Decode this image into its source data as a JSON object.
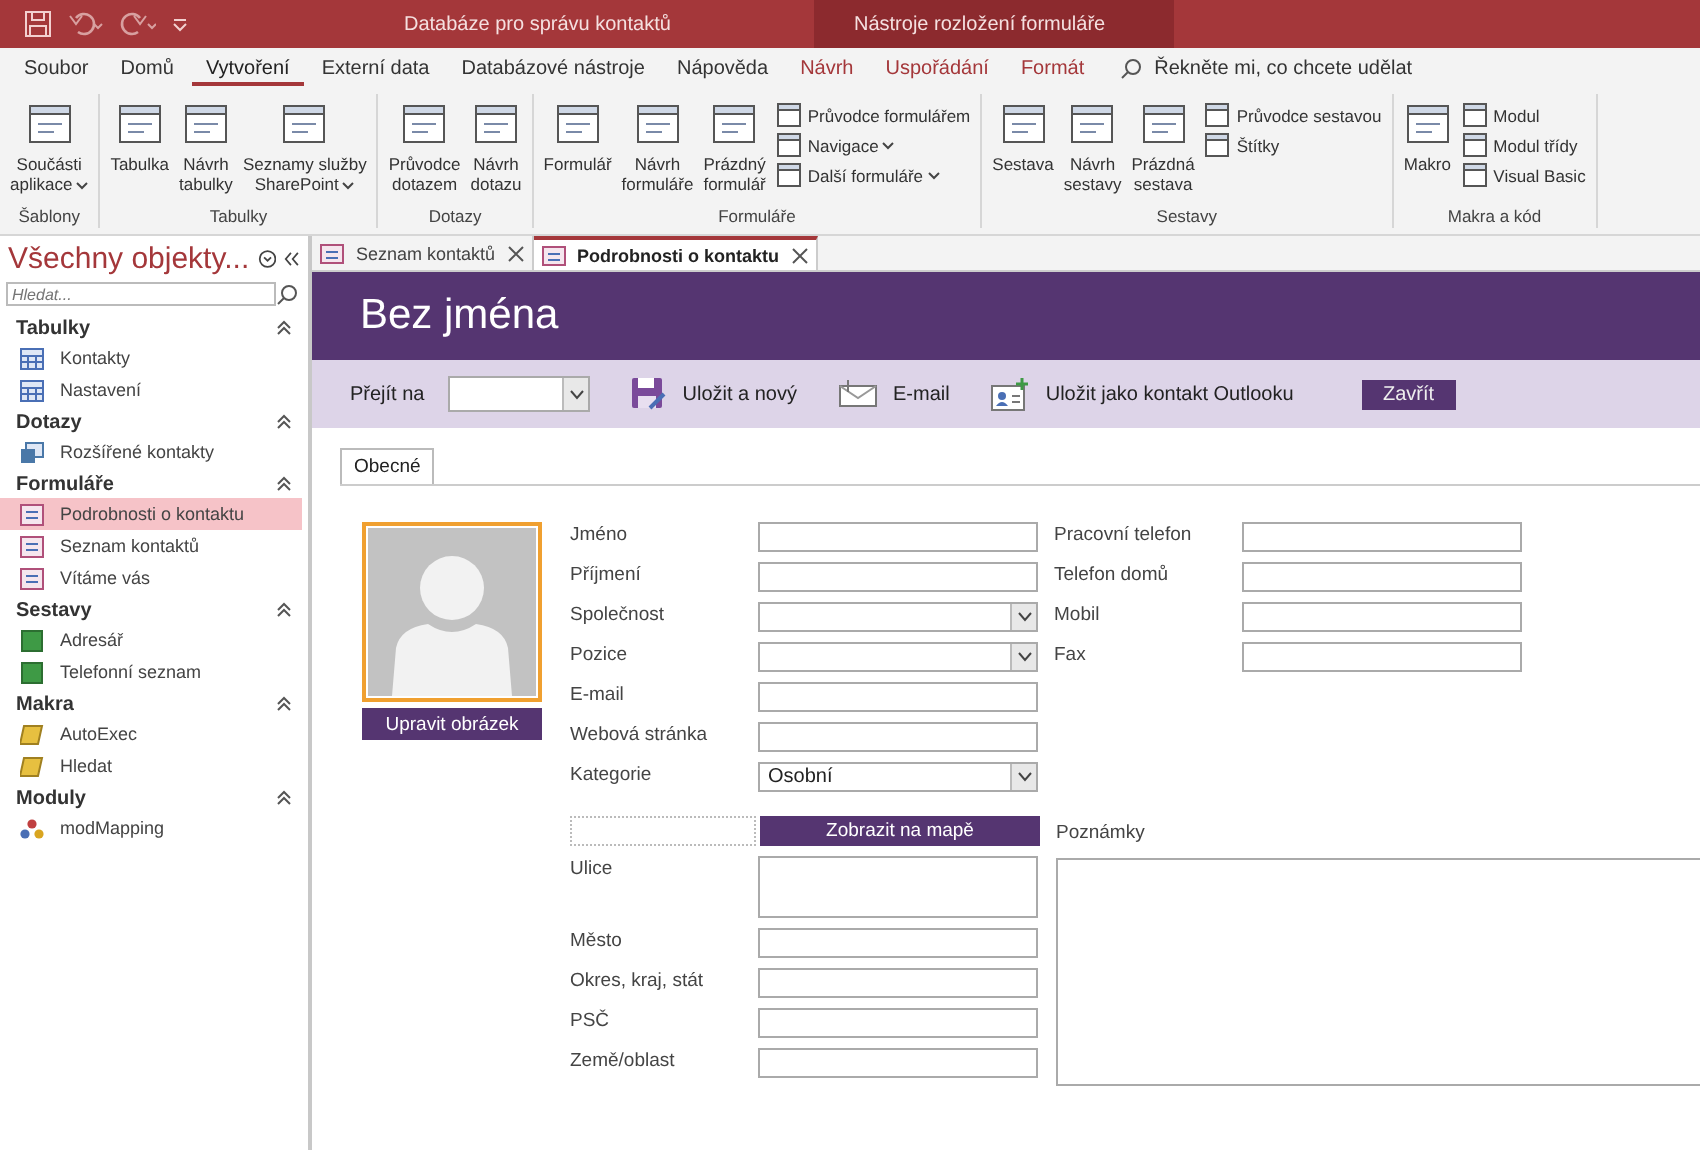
{
  "title_bar": {
    "title": "Databáze pro správu kontaktů",
    "context_title": "Nástroje rozložení formuláře"
  },
  "ribbon_tabs": [
    {
      "label": "Soubor",
      "selected": false,
      "contextual": false
    },
    {
      "label": "Domů",
      "selected": false,
      "contextual": false
    },
    {
      "label": "Vytvoření",
      "selected": true,
      "contextual": false
    },
    {
      "label": "Externí data",
      "selected": false,
      "contextual": false
    },
    {
      "label": "Databázové nástroje",
      "selected": false,
      "contextual": false
    },
    {
      "label": "Nápověda",
      "selected": false,
      "contextual": false
    },
    {
      "label": "Návrh",
      "selected": false,
      "contextual": true
    },
    {
      "label": "Uspořádání",
      "selected": false,
      "contextual": true
    },
    {
      "label": "Formát",
      "selected": false,
      "contextual": true
    }
  ],
  "tell_me": {
    "label": "Řekněte mi, co chcete udělat"
  },
  "ribbon_groups": [
    {
      "label": "Šablony",
      "items": [
        {
          "kind": "large",
          "label": "Součásti\naplikace",
          "dropdown": true
        }
      ]
    },
    {
      "label": "Tabulky",
      "items": [
        {
          "kind": "large",
          "label": "Tabulka",
          "dropdown": false
        },
        {
          "kind": "large",
          "label": "Návrh\ntabulky",
          "dropdown": false
        },
        {
          "kind": "large",
          "label": "Seznamy služby\nSharePoint",
          "dropdown": true
        }
      ]
    },
    {
      "label": "Dotazy",
      "items": [
        {
          "kind": "large",
          "label": "Průvodce\ndotazem",
          "dropdown": false
        },
        {
          "kind": "large",
          "label": "Návrh\ndotazu",
          "dropdown": false
        }
      ]
    },
    {
      "label": "Formuláře",
      "items": [
        {
          "kind": "large",
          "label": "Formulář",
          "dropdown": false
        },
        {
          "kind": "large",
          "label": "Návrh\nformuláře",
          "dropdown": false
        },
        {
          "kind": "large",
          "label": "Prázdný\nformulář",
          "dropdown": false
        },
        {
          "kind": "small",
          "label": "Průvodce formulářem",
          "dropdown": false
        },
        {
          "kind": "small",
          "label": "Navigace",
          "dropdown": true
        },
        {
          "kind": "small",
          "label": "Další formuláře",
          "dropdown": true
        }
      ]
    },
    {
      "label": "Sestavy",
      "items": [
        {
          "kind": "large",
          "label": "Sestava",
          "dropdown": false
        },
        {
          "kind": "large",
          "label": "Návrh\nsestavy",
          "dropdown": false
        },
        {
          "kind": "large",
          "label": "Prázdná\nsestava",
          "dropdown": false
        },
        {
          "kind": "small",
          "label": "Průvodce sestavou",
          "dropdown": false
        },
        {
          "kind": "small",
          "label": "Štítky",
          "dropdown": false
        }
      ]
    },
    {
      "label": "Makra a kód",
      "items": [
        {
          "kind": "large",
          "label": "Makro",
          "dropdown": false
        },
        {
          "kind": "small",
          "label": "Modul",
          "dropdown": false
        },
        {
          "kind": "small",
          "label": "Modul třídy",
          "dropdown": false
        },
        {
          "kind": "small",
          "label": "Visual Basic",
          "dropdown": false
        }
      ]
    }
  ],
  "nav": {
    "title": "Všechny objekty...",
    "search": {
      "placeholder": "Hledat..."
    },
    "sections": [
      {
        "label": "Tabulky",
        "kind": "table",
        "items": [
          {
            "label": "Kontakty",
            "selected": false
          },
          {
            "label": "Nastavení",
            "selected": false
          }
        ]
      },
      {
        "label": "Dotazy",
        "kind": "query",
        "items": [
          {
            "label": "Rozšířené kontakty",
            "selected": false
          }
        ]
      },
      {
        "label": "Formuláře",
        "kind": "form",
        "items": [
          {
            "label": "Podrobnosti o kontaktu",
            "selected": true
          },
          {
            "label": "Seznam kontaktů",
            "selected": false
          },
          {
            "label": "Vítáme vás",
            "selected": false
          }
        ]
      },
      {
        "label": "Sestavy",
        "kind": "report",
        "items": [
          {
            "label": "Adresář",
            "selected": false
          },
          {
            "label": "Telefonní seznam",
            "selected": false
          }
        ]
      },
      {
        "label": "Makra",
        "kind": "macro",
        "items": [
          {
            "label": "AutoExec",
            "selected": false
          },
          {
            "label": "Hledat",
            "selected": false
          }
        ]
      },
      {
        "label": "Moduly",
        "kind": "module",
        "items": [
          {
            "label": "modMapping",
            "selected": false
          }
        ]
      }
    ]
  },
  "doc_tabs": [
    {
      "label": "Seznam kontaktů",
      "selected": false
    },
    {
      "label": "Podrobnosti o kontaktu",
      "selected": true
    }
  ],
  "form": {
    "title": "Bez jména",
    "toolbar": {
      "goto_label": "Přejít na",
      "actions": [
        {
          "kind": "save",
          "label": "Uložit a nový"
        },
        {
          "kind": "email",
          "label": "E-mail"
        },
        {
          "kind": "contact",
          "label": "Uložit jako kontakt Outlooku"
        }
      ],
      "close": "Zavřít"
    },
    "tabs": [
      {
        "label": "Obecné",
        "selected": true
      }
    ],
    "photo_button": "Upravit obrázek",
    "left_fields": [
      {
        "label": "Jméno",
        "kind": "text"
      },
      {
        "label": "Příjmení",
        "kind": "text"
      },
      {
        "label": "Společnost",
        "kind": "combo"
      },
      {
        "label": "Pozice",
        "kind": "combo"
      },
      {
        "label": "E-mail",
        "kind": "text"
      },
      {
        "label": "Webová stránka",
        "kind": "text"
      },
      {
        "label": "Kategorie",
        "kind": "combo",
        "value": "Osobní"
      }
    ],
    "right_fields": [
      {
        "label": "Pracovní telefon",
        "kind": "text"
      },
      {
        "label": "Telefon domů",
        "kind": "text"
      },
      {
        "label": "Mobil",
        "kind": "text"
      },
      {
        "label": "Fax",
        "kind": "text"
      }
    ],
    "map_button": "Zobrazit na mapě",
    "address_fields": [
      {
        "label": "Ulice",
        "kind": "memo"
      },
      {
        "label": "Město",
        "kind": "text"
      },
      {
        "label": "Okres, kraj, stát",
        "kind": "text"
      },
      {
        "label": "PSČ",
        "kind": "text"
      },
      {
        "label": "Země/oblast",
        "kind": "text"
      }
    ],
    "notes": {
      "label": "Poznámky"
    }
  }
}
